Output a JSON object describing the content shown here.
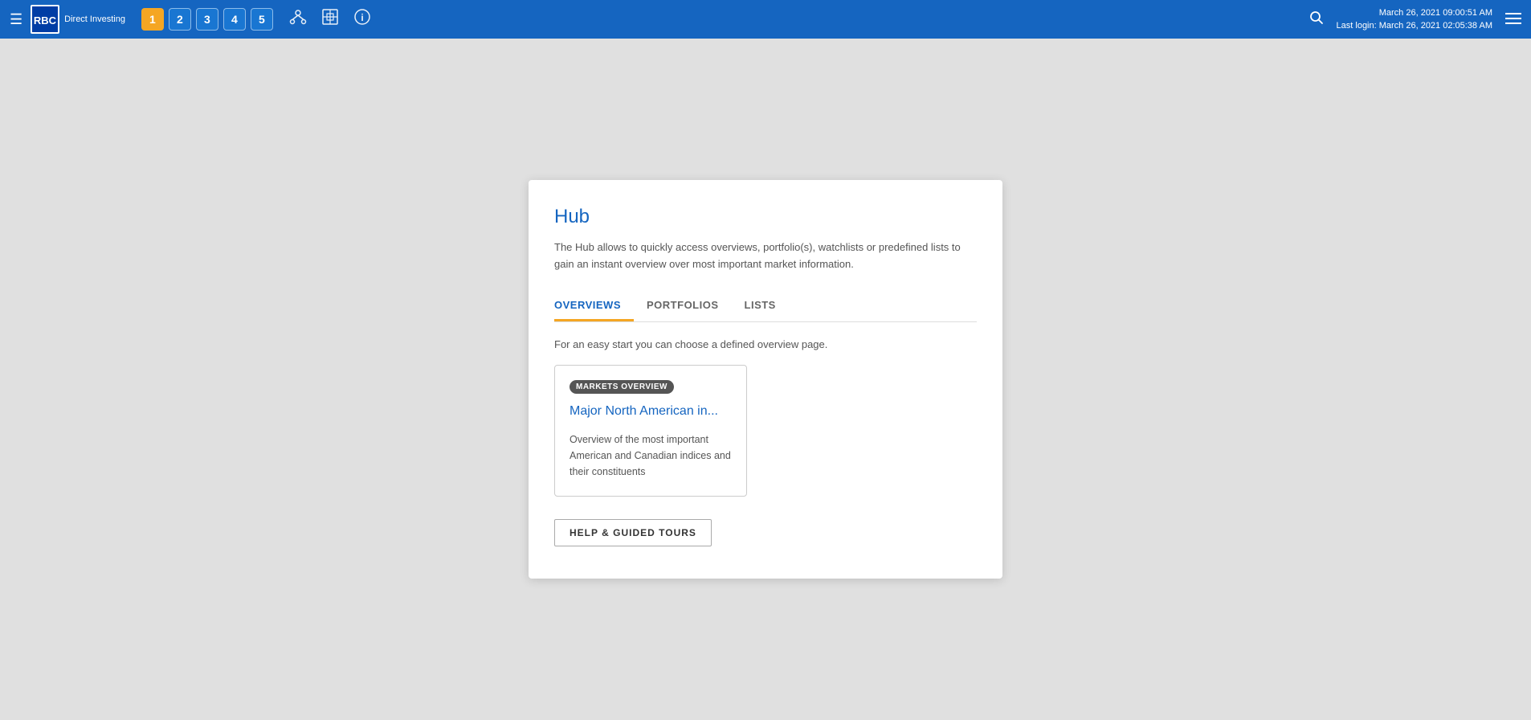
{
  "navbar": {
    "hamburger_icon": "☰",
    "brand": {
      "name": "Direct Investing",
      "logo_text": "RBC"
    },
    "tabs": [
      {
        "label": "1",
        "active": true
      },
      {
        "label": "2",
        "active": false
      },
      {
        "label": "3",
        "active": false
      },
      {
        "label": "4",
        "active": false
      },
      {
        "label": "5",
        "active": false
      }
    ],
    "icons": {
      "network": "⑂",
      "crosshair": "⊕",
      "info": "ℹ"
    },
    "datetime": "March 26, 2021 09:00:51 AM",
    "last_login": "Last login: March 26, 2021 02:05:38 AM",
    "search_icon": "🔍",
    "menu_icon": "▬"
  },
  "hub": {
    "title": "Hub",
    "description": "The Hub allows to quickly access overviews, portfolio(s), watchlists or predefined lists to gain an instant overview over most important market information.",
    "tabs": [
      {
        "label": "OVERVIEWS",
        "active": true
      },
      {
        "label": "PORTFOLIOS",
        "active": false
      },
      {
        "label": "LISTS",
        "active": false
      }
    ],
    "overview_description": "For an easy start you can choose a defined overview page.",
    "card": {
      "badge": "MARKETS OVERVIEW",
      "title": "Major North American in...",
      "body": "Overview of the most important American and Canadian indices and their constituents"
    },
    "help_button_label": "HELP & GUIDED TOURS"
  }
}
